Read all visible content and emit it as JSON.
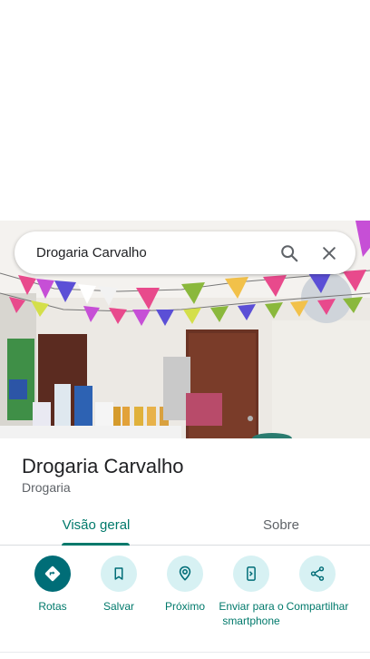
{
  "search": {
    "query": "Drogaria Carvalho"
  },
  "place": {
    "name": "Drogaria Carvalho",
    "category": "Drogaria"
  },
  "tabs": [
    {
      "label": "Visão geral",
      "selected": true
    },
    {
      "label": "Sobre",
      "selected": false
    }
  ],
  "actions": [
    {
      "label": "Rotas",
      "icon": "directions-icon",
      "primary": true
    },
    {
      "label": "Salvar",
      "icon": "bookmark-icon"
    },
    {
      "label": "Próximo",
      "icon": "nearby-icon"
    },
    {
      "label": "Enviar para o smartphone",
      "icon": "send-to-phone-icon"
    },
    {
      "label": "Compartilhar",
      "icon": "share-icon"
    }
  ],
  "colors": {
    "accent": "#00796b",
    "primary_action": "#006d77",
    "action_bg": "#d7f1f3"
  }
}
